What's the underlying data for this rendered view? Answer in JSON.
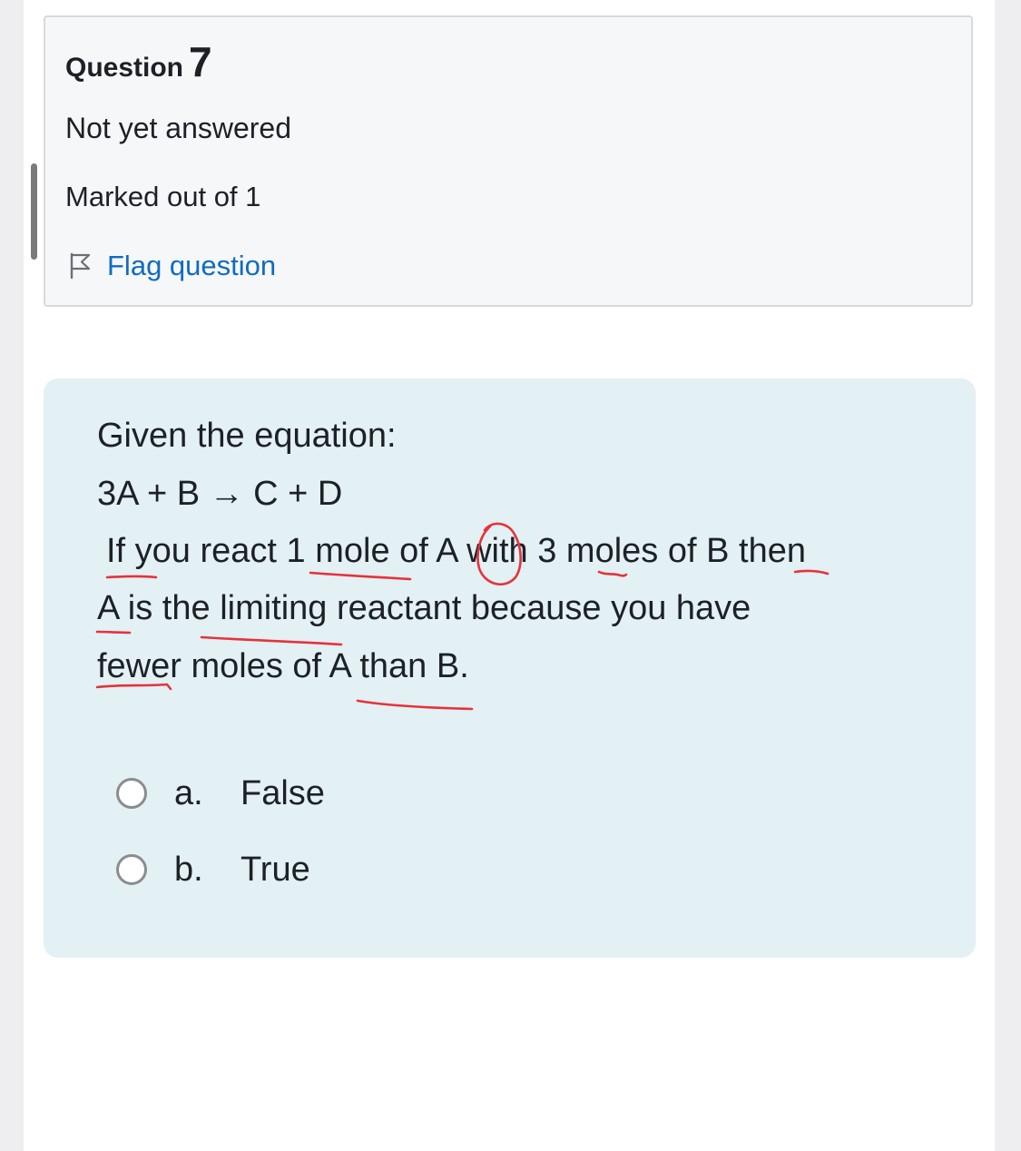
{
  "question": {
    "title_label": "Question",
    "number": "7",
    "status": "Not yet answered",
    "marks": "Marked out of 1",
    "flag_label": "Flag question"
  },
  "question_text": {
    "intro": "Given the equation:",
    "equation": "3A + B → C + D",
    "lines": [
      "If you react 1 mole of A with 3 moles of B then",
      "A is the limiting reactant because you have",
      "fewer moles of A than B."
    ]
  },
  "answers": [
    {
      "letter": "a.",
      "text": "False",
      "selected": false
    },
    {
      "letter": "b.",
      "text": "True",
      "selected": false
    }
  ],
  "colors": {
    "link": "#0f6cbf",
    "formulation_background": "#e3f0f4",
    "annotation_ink": "#e5333b"
  },
  "icons": {
    "flag": "flag-icon"
  }
}
